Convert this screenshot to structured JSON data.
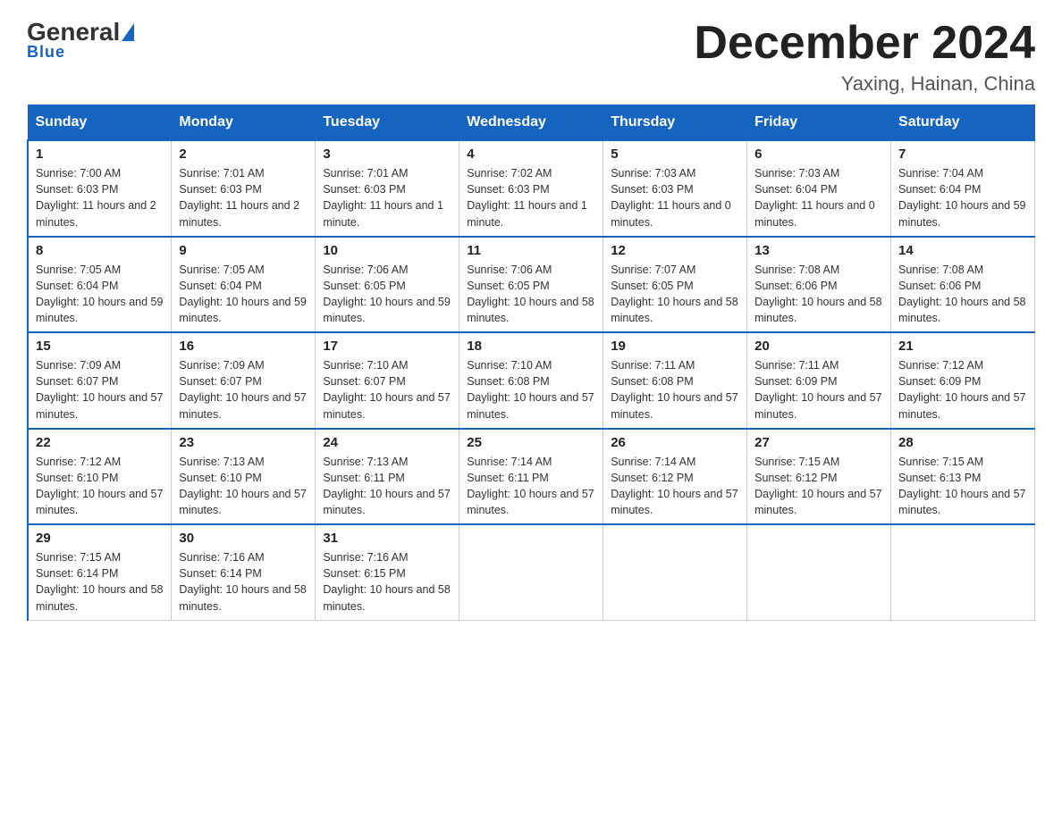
{
  "header": {
    "logo": {
      "general": "General",
      "blue": "Blue"
    },
    "title": "December 2024",
    "location": "Yaxing, Hainan, China"
  },
  "weekdays": [
    "Sunday",
    "Monday",
    "Tuesday",
    "Wednesday",
    "Thursday",
    "Friday",
    "Saturday"
  ],
  "weeks": [
    [
      {
        "day": 1,
        "sunrise": "7:00 AM",
        "sunset": "6:03 PM",
        "daylight": "11 hours and 2 minutes."
      },
      {
        "day": 2,
        "sunrise": "7:01 AM",
        "sunset": "6:03 PM",
        "daylight": "11 hours and 2 minutes."
      },
      {
        "day": 3,
        "sunrise": "7:01 AM",
        "sunset": "6:03 PM",
        "daylight": "11 hours and 1 minute."
      },
      {
        "day": 4,
        "sunrise": "7:02 AM",
        "sunset": "6:03 PM",
        "daylight": "11 hours and 1 minute."
      },
      {
        "day": 5,
        "sunrise": "7:03 AM",
        "sunset": "6:03 PM",
        "daylight": "11 hours and 0 minutes."
      },
      {
        "day": 6,
        "sunrise": "7:03 AM",
        "sunset": "6:04 PM",
        "daylight": "11 hours and 0 minutes."
      },
      {
        "day": 7,
        "sunrise": "7:04 AM",
        "sunset": "6:04 PM",
        "daylight": "10 hours and 59 minutes."
      }
    ],
    [
      {
        "day": 8,
        "sunrise": "7:05 AM",
        "sunset": "6:04 PM",
        "daylight": "10 hours and 59 minutes."
      },
      {
        "day": 9,
        "sunrise": "7:05 AM",
        "sunset": "6:04 PM",
        "daylight": "10 hours and 59 minutes."
      },
      {
        "day": 10,
        "sunrise": "7:06 AM",
        "sunset": "6:05 PM",
        "daylight": "10 hours and 59 minutes."
      },
      {
        "day": 11,
        "sunrise": "7:06 AM",
        "sunset": "6:05 PM",
        "daylight": "10 hours and 58 minutes."
      },
      {
        "day": 12,
        "sunrise": "7:07 AM",
        "sunset": "6:05 PM",
        "daylight": "10 hours and 58 minutes."
      },
      {
        "day": 13,
        "sunrise": "7:08 AM",
        "sunset": "6:06 PM",
        "daylight": "10 hours and 58 minutes."
      },
      {
        "day": 14,
        "sunrise": "7:08 AM",
        "sunset": "6:06 PM",
        "daylight": "10 hours and 58 minutes."
      }
    ],
    [
      {
        "day": 15,
        "sunrise": "7:09 AM",
        "sunset": "6:07 PM",
        "daylight": "10 hours and 57 minutes."
      },
      {
        "day": 16,
        "sunrise": "7:09 AM",
        "sunset": "6:07 PM",
        "daylight": "10 hours and 57 minutes."
      },
      {
        "day": 17,
        "sunrise": "7:10 AM",
        "sunset": "6:07 PM",
        "daylight": "10 hours and 57 minutes."
      },
      {
        "day": 18,
        "sunrise": "7:10 AM",
        "sunset": "6:08 PM",
        "daylight": "10 hours and 57 minutes."
      },
      {
        "day": 19,
        "sunrise": "7:11 AM",
        "sunset": "6:08 PM",
        "daylight": "10 hours and 57 minutes."
      },
      {
        "day": 20,
        "sunrise": "7:11 AM",
        "sunset": "6:09 PM",
        "daylight": "10 hours and 57 minutes."
      },
      {
        "day": 21,
        "sunrise": "7:12 AM",
        "sunset": "6:09 PM",
        "daylight": "10 hours and 57 minutes."
      }
    ],
    [
      {
        "day": 22,
        "sunrise": "7:12 AM",
        "sunset": "6:10 PM",
        "daylight": "10 hours and 57 minutes."
      },
      {
        "day": 23,
        "sunrise": "7:13 AM",
        "sunset": "6:10 PM",
        "daylight": "10 hours and 57 minutes."
      },
      {
        "day": 24,
        "sunrise": "7:13 AM",
        "sunset": "6:11 PM",
        "daylight": "10 hours and 57 minutes."
      },
      {
        "day": 25,
        "sunrise": "7:14 AM",
        "sunset": "6:11 PM",
        "daylight": "10 hours and 57 minutes."
      },
      {
        "day": 26,
        "sunrise": "7:14 AM",
        "sunset": "6:12 PM",
        "daylight": "10 hours and 57 minutes."
      },
      {
        "day": 27,
        "sunrise": "7:15 AM",
        "sunset": "6:12 PM",
        "daylight": "10 hours and 57 minutes."
      },
      {
        "day": 28,
        "sunrise": "7:15 AM",
        "sunset": "6:13 PM",
        "daylight": "10 hours and 57 minutes."
      }
    ],
    [
      {
        "day": 29,
        "sunrise": "7:15 AM",
        "sunset": "6:14 PM",
        "daylight": "10 hours and 58 minutes."
      },
      {
        "day": 30,
        "sunrise": "7:16 AM",
        "sunset": "6:14 PM",
        "daylight": "10 hours and 58 minutes."
      },
      {
        "day": 31,
        "sunrise": "7:16 AM",
        "sunset": "6:15 PM",
        "daylight": "10 hours and 58 minutes."
      },
      null,
      null,
      null,
      null
    ]
  ],
  "labels": {
    "sunrise": "Sunrise:",
    "sunset": "Sunset:",
    "daylight": "Daylight:"
  }
}
